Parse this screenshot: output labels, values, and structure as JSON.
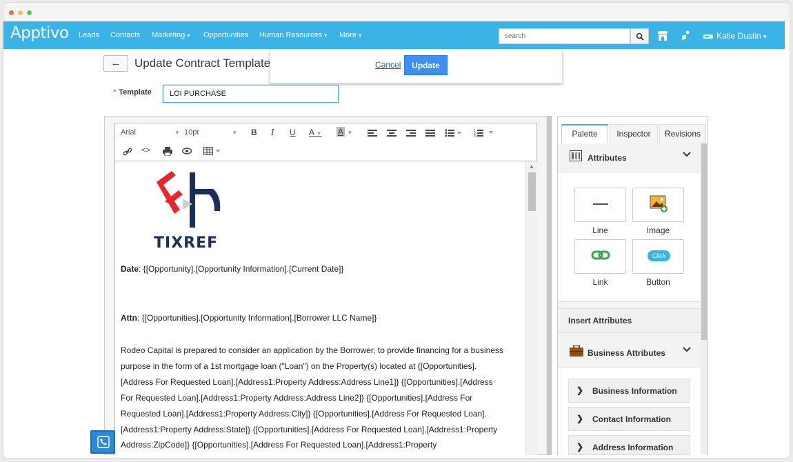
{
  "app": {
    "logo_text": "Apptivo",
    "nav": [
      {
        "label": "Leads"
      },
      {
        "label": "Contacts"
      },
      {
        "label": "Marketing",
        "caret": "▾"
      },
      {
        "label": "Opportunities"
      },
      {
        "label": "Human Resources",
        "caret": "▾"
      },
      {
        "label": "More",
        "caret": "▾"
      }
    ],
    "search_placeholder": "search",
    "user_name": "Katie Dustin",
    "user_caret": "▾"
  },
  "page": {
    "title": "Update Contract Template",
    "cancel_label": "Cancel",
    "update_label": "Update",
    "template_label": "Template",
    "template_required_mark": "*",
    "template_value": "LOI PURCHASE"
  },
  "toolbar": {
    "font_family": "Arial",
    "font_size": "10pt",
    "bold": "B",
    "italic": "I",
    "underline": "U",
    "text_color": "A",
    "bg_color": "A"
  },
  "document": {
    "logo_text": "TIXREF",
    "date_label": "Date",
    "date_value": ": {[Opportunity].[Opportunity Information].[Current Date]}",
    "attn_label": "Attn",
    "attn_value": ": {[Opportunities].[Opportunity Information].[Borrower LLC Name]}",
    "body_lines": [
      "Rodeo Capital is prepared to consider an application by the Borrower, to provide financing for a business",
      "purpose in the form of a 1st mortgage loan (\"Loan\") on the Property(s) located at  {[Opportunities].",
      "[Address For Requested Loan].[Address1:Property Address:Address Line1]} {[Opportunities].[Address",
      "For Requested Loan].[Address1:Property Address:Address Line2]} {[Opportunities].[Address For",
      "Requested Loan].[Address1:Property Address:City]} {[Opportunities].[Address For Requested Loan].",
      "[Address1:Property Address:State]} {[Opportunities].[Address For Requested Loan].[Address1:Property",
      "Address:ZipCode]} {[Opportunities].[Address For Requested Loan].[Address1:Property"
    ]
  },
  "panel": {
    "tabs": [
      "Palette",
      "Inspector",
      "Revisions"
    ],
    "attributes_title": "Attributes",
    "attribute_items": [
      {
        "label": "Line"
      },
      {
        "label": "Image"
      },
      {
        "label": "Link"
      },
      {
        "label": "Button",
        "badge": "Click"
      }
    ],
    "insert_title": "Insert Attributes",
    "business_title": "Business Attributes",
    "business_items": [
      {
        "label": "Business Information"
      },
      {
        "label": "Contact Information"
      },
      {
        "label": "Address Information"
      }
    ]
  },
  "colors": {
    "brand": "#3ab4e6",
    "primary_button": "#3e8ff0",
    "logo_red": "#e8262b",
    "logo_navy": "#1b2f5d"
  }
}
